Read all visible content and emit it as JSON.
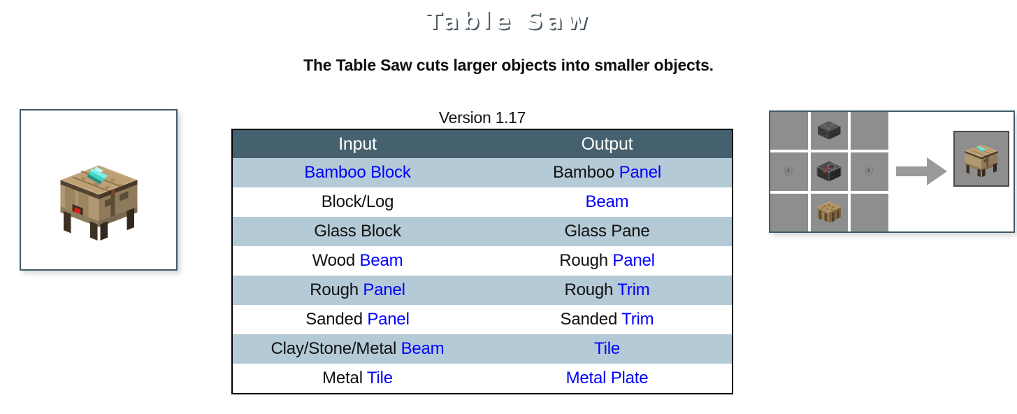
{
  "header": {
    "title": "Table Saw"
  },
  "subtitle": "The Table Saw cuts larger objects into smaller objects.",
  "version_label": "Version 1.17",
  "table": {
    "columns": [
      "Input",
      "Output"
    ],
    "rows": [
      {
        "input": [
          {
            "text": "Bamboo Block",
            "color": "blue"
          }
        ],
        "output": [
          {
            "text": "Bamboo ",
            "color": "black"
          },
          {
            "text": "Panel",
            "color": "blue"
          }
        ]
      },
      {
        "input": [
          {
            "text": "Block/Log",
            "color": "black"
          }
        ],
        "output": [
          {
            "text": "Beam",
            "color": "blue"
          }
        ]
      },
      {
        "input": [
          {
            "text": "Glass Block",
            "color": "black"
          }
        ],
        "output": [
          {
            "text": "Glass Pane",
            "color": "black"
          }
        ]
      },
      {
        "input": [
          {
            "text": "Wood ",
            "color": "black"
          },
          {
            "text": "Beam",
            "color": "blue"
          }
        ],
        "output": [
          {
            "text": "Rough ",
            "color": "black"
          },
          {
            "text": "Panel",
            "color": "blue"
          }
        ]
      },
      {
        "input": [
          {
            "text": "Rough ",
            "color": "black"
          },
          {
            "text": "Panel",
            "color": "blue"
          }
        ],
        "output": [
          {
            "text": "Rough ",
            "color": "black"
          },
          {
            "text": "Trim",
            "color": "blue"
          }
        ]
      },
      {
        "input": [
          {
            "text": "Sanded ",
            "color": "black"
          },
          {
            "text": "Panel",
            "color": "blue"
          }
        ],
        "output": [
          {
            "text": "Sanded ",
            "color": "black"
          },
          {
            "text": "Trim",
            "color": "blue"
          }
        ]
      },
      {
        "input": [
          {
            "text": "Clay/Stone/Metal ",
            "color": "black"
          },
          {
            "text": "Beam",
            "color": "blue"
          }
        ],
        "output": [
          {
            "text": "Tile",
            "color": "blue"
          }
        ]
      },
      {
        "input": [
          {
            "text": "Metal ",
            "color": "black"
          },
          {
            "text": "Tile",
            "color": "blue"
          }
        ],
        "output": [
          {
            "text": "Metal Plate",
            "color": "blue"
          }
        ]
      }
    ]
  },
  "block_preview": {
    "icon": "table-saw-block-icon",
    "alt": "Table Saw block"
  },
  "crafting": {
    "grid": [
      {
        "slot": 1,
        "item": "",
        "icon": "empty-slot"
      },
      {
        "slot": 2,
        "item": "Metal Block",
        "icon": "metal-block-icon"
      },
      {
        "slot": 3,
        "item": "",
        "icon": "empty-slot"
      },
      {
        "slot": 4,
        "item": "Iron Nugget",
        "icon": "iron-nugget-icon"
      },
      {
        "slot": 5,
        "item": "Machine Frame",
        "icon": "machine-frame-icon"
      },
      {
        "slot": 6,
        "item": "Iron Nugget",
        "icon": "iron-nugget-icon"
      },
      {
        "slot": 7,
        "item": "",
        "icon": "empty-slot"
      },
      {
        "slot": 8,
        "item": "Crafting Table",
        "icon": "crafting-table-icon"
      },
      {
        "slot": 9,
        "item": "",
        "icon": "empty-slot"
      }
    ],
    "arrow_icon": "right-arrow-icon",
    "result": {
      "item": "Table Saw",
      "icon": "table-saw-block-icon"
    }
  },
  "colors": {
    "header_accent": "#7ea2b5",
    "table_header_bg": "#45616f",
    "table_alt_row_bg": "#b4cad6",
    "link_blue": "#0000ff",
    "frame_border": "#3f5c6a",
    "slot_gray": "#8e8e8e"
  }
}
